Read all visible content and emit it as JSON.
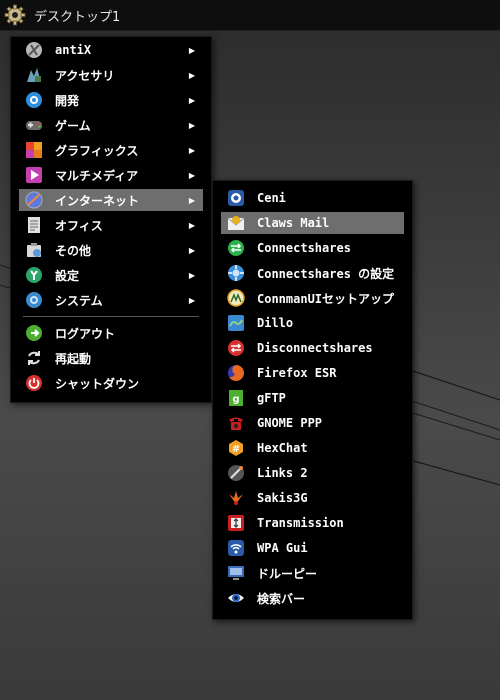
{
  "taskbar": {
    "title": "デスクトップ1"
  },
  "main_menu": {
    "items": [
      {
        "label": "antiX",
        "icon": "antix-icon",
        "color": "#b8b8b8",
        "submenu": true
      },
      {
        "label": "アクセサリ",
        "icon": "accessories-icon",
        "color": "#5a8fa8",
        "submenu": true
      },
      {
        "label": "開発",
        "icon": "development-icon",
        "color": "#2e8ee0",
        "submenu": true
      },
      {
        "label": "ゲーム",
        "icon": "gamepad-icon",
        "color": "#6a6a6a",
        "submenu": true
      },
      {
        "label": "グラフィックス",
        "icon": "graphics-icon",
        "color": "#e8452c",
        "submenu": true
      },
      {
        "label": "マルチメディア",
        "icon": "multimedia-icon",
        "color": "#c43fb0",
        "submenu": true
      },
      {
        "label": "インターネット",
        "icon": "internet-icon",
        "color": "#5f79d8",
        "submenu": true
      },
      {
        "label": "オフィス",
        "icon": "office-icon",
        "color": "#d0d0d0",
        "submenu": true
      },
      {
        "label": "その他",
        "icon": "other-icon",
        "color": "#5a9ad8",
        "submenu": true
      },
      {
        "label": "設定",
        "icon": "settings-icon",
        "color": "#2aa56a",
        "submenu": true
      },
      {
        "label": "システム",
        "icon": "system-icon",
        "color": "#3a8ad0",
        "submenu": true
      },
      {
        "label": "ログアウト",
        "icon": "logout-icon",
        "color": "#4caf32",
        "submenu": false
      },
      {
        "label": "再起動",
        "icon": "restart-icon",
        "color": "#e0e0e0",
        "submenu": false
      },
      {
        "label": "シャットダウン",
        "icon": "shutdown-icon",
        "color": "#d83030",
        "submenu": false
      }
    ],
    "highlighted": "インターネット",
    "arrow": "▶"
  },
  "internet_menu": {
    "items": [
      {
        "label": "Ceni",
        "icon": "ceni-icon",
        "color": "#2a5aa8"
      },
      {
        "label": "Claws Mail",
        "icon": "claws-mail-icon",
        "color": "#e8b020"
      },
      {
        "label": "Connectshares",
        "icon": "connectshares-icon",
        "color": "#2cb24a"
      },
      {
        "label": "Connectshares の設定",
        "icon": "connectshares-settings-icon",
        "color": "#3a90d8"
      },
      {
        "label": "ConnmanUIセットアップ",
        "icon": "connman-icon",
        "color": "#e0a020"
      },
      {
        "label": "Dillo",
        "icon": "dillo-icon",
        "color": "#3a88d0"
      },
      {
        "label": "Disconnectshares",
        "icon": "disconnectshares-icon",
        "color": "#d83030"
      },
      {
        "label": "Firefox ESR",
        "icon": "firefox-icon",
        "color": "#e86a20"
      },
      {
        "label": "gFTP",
        "icon": "gftp-icon",
        "color": "#4caf32"
      },
      {
        "label": "GNOME PPP",
        "icon": "phone-icon",
        "color": "#c82020"
      },
      {
        "label": "HexChat",
        "icon": "hexchat-icon",
        "color": "#f0a020"
      },
      {
        "label": "Links 2",
        "icon": "links-icon",
        "color": "#555555"
      },
      {
        "label": "Sakis3G",
        "icon": "sakis3g-icon",
        "color": "#e86a20"
      },
      {
        "label": "Transmission",
        "icon": "transmission-icon",
        "color": "#c82020"
      },
      {
        "label": "WPA Gui",
        "icon": "wifi-icon",
        "color": "#2a5aa8"
      },
      {
        "label": "ドルーピー",
        "icon": "monitor-icon",
        "color": "#3a6ab8"
      },
      {
        "label": "検索バー",
        "icon": "eye-icon",
        "color": "#2a6ad0"
      }
    ],
    "highlighted": "Claws Mail"
  }
}
